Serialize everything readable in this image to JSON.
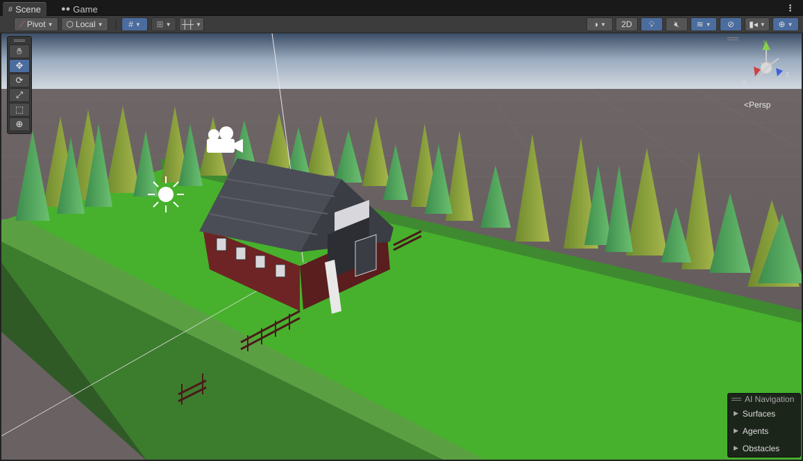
{
  "tabs": [
    {
      "label": "Scene",
      "icon": "grid-icon",
      "active": true
    },
    {
      "label": "Game",
      "icon": "gamepad-icon",
      "active": false
    }
  ],
  "toolbar": {
    "pivot_label": "Pivot",
    "local_label": "Local",
    "mode_2d_label": "2D"
  },
  "tools": [
    "hand-tool",
    "move-tool",
    "rotate-tool",
    "scale-tool",
    "rect-tool",
    "transform-tool"
  ],
  "gizmo": {
    "projection_label": "Persp",
    "axis_x": "x",
    "axis_y": "y",
    "axis_z": "z"
  },
  "overlay": {
    "title": "AI Navigation",
    "items": [
      "Surfaces",
      "Agents",
      "Obstacles"
    ]
  },
  "colors": {
    "accent": "#4b6c9e",
    "grass": "#47b12d",
    "sky": "#c7d2de",
    "barn_red": "#6e2424"
  }
}
